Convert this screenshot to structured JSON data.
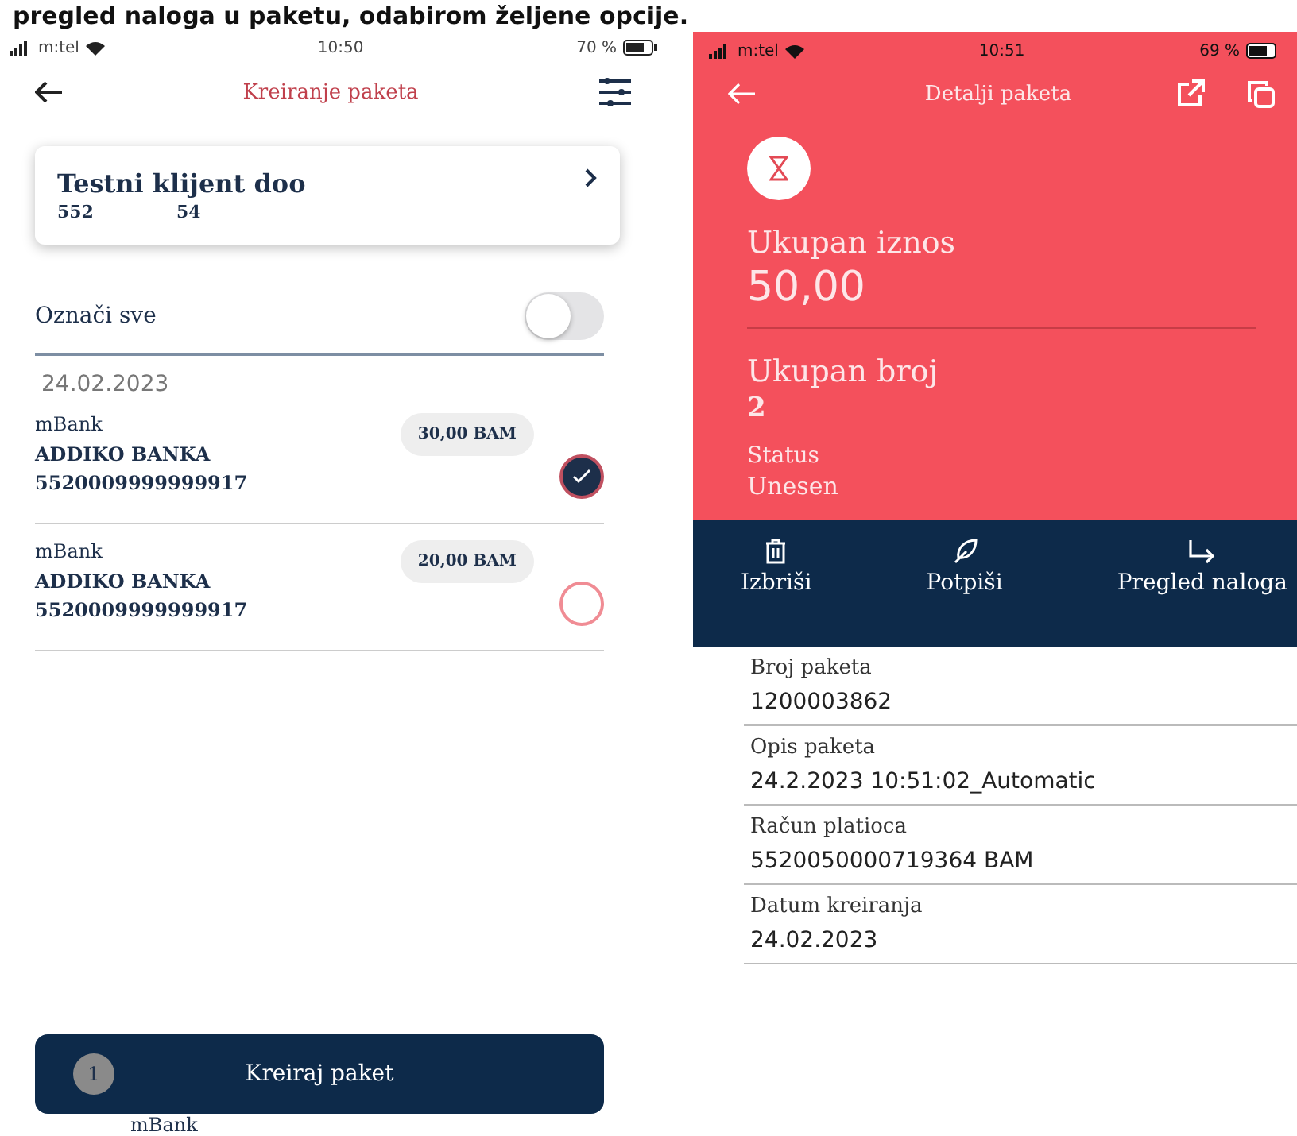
{
  "caption": "pregled naloga u paketu, odabirom željene opcije.",
  "left_screen": {
    "status_bar": {
      "carrier": "m:tel",
      "time": "10:50",
      "battery": "70 %"
    },
    "title": "Kreiranje paketa",
    "client": {
      "name": "Testni klijent doo",
      "code_1": "552",
      "code_2": "54"
    },
    "select_all": {
      "label": "Označi sve",
      "on": false
    },
    "date": "24.02.2023",
    "payments": [
      {
        "payer": "mBank",
        "bank": "ADDIKO BANKA",
        "account": "5520009999999917",
        "amount": "30,00 BAM",
        "selected": true
      },
      {
        "payer": "mBank",
        "bank": "ADDIKO BANKA",
        "account": "5520009999999917",
        "amount": "20,00 BAM",
        "selected": false
      }
    ],
    "create_button": {
      "badge": "1",
      "label": "Kreiraj paket"
    },
    "peek_text": "mBank"
  },
  "right_screen": {
    "status_bar": {
      "carrier": "m:tel",
      "time": "10:51",
      "battery": "69 %"
    },
    "title": "Detalji paketa",
    "total_amount": {
      "label": "Ukupan iznos",
      "value": "50,00"
    },
    "total_count": {
      "label": "Ukupan broj",
      "value": "2"
    },
    "status": {
      "label": "Status",
      "value": "Unesen"
    },
    "actions": [
      {
        "kind": "delete",
        "label": "Izbriši"
      },
      {
        "kind": "sign",
        "label": "Potpiši"
      },
      {
        "kind": "forward",
        "label": "Pregled naloga"
      }
    ],
    "details": [
      {
        "label": "Broj paketa",
        "value": "1200003862"
      },
      {
        "label": "Opis paketa",
        "value": "24.2.2023 10:51:02_Automatic"
      },
      {
        "label": "Račun platioca",
        "value": "5520050000719364 BAM"
      },
      {
        "label": "Datum kreiranja",
        "value": "24.02.2023"
      }
    ]
  }
}
